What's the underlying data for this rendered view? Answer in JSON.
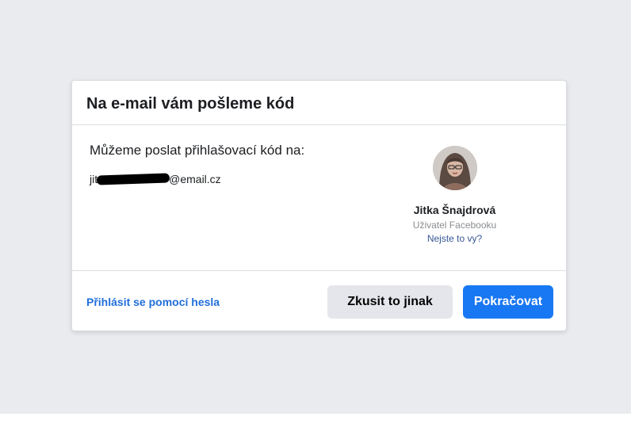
{
  "dialog": {
    "title": "Na e-mail vám pošleme kód",
    "prompt": "Můžeme poslat přihlašovací kód na:",
    "email": {
      "prefix": "jit",
      "suffix": "@email.cz"
    },
    "profile": {
      "name": "Jitka Šnajdrová",
      "role": "Uživatel Facebooku",
      "not_you": "Nejste to vy?"
    },
    "footer": {
      "password_link": "Přihlásit se pomocí hesla",
      "try_another": "Zkusit to jinak",
      "continue": "Pokračovat"
    }
  },
  "colors": {
    "backdrop": "#e9ebee",
    "primary": "#1877f2",
    "link": "#216fdb",
    "secondary_button": "#e4e6eb"
  }
}
